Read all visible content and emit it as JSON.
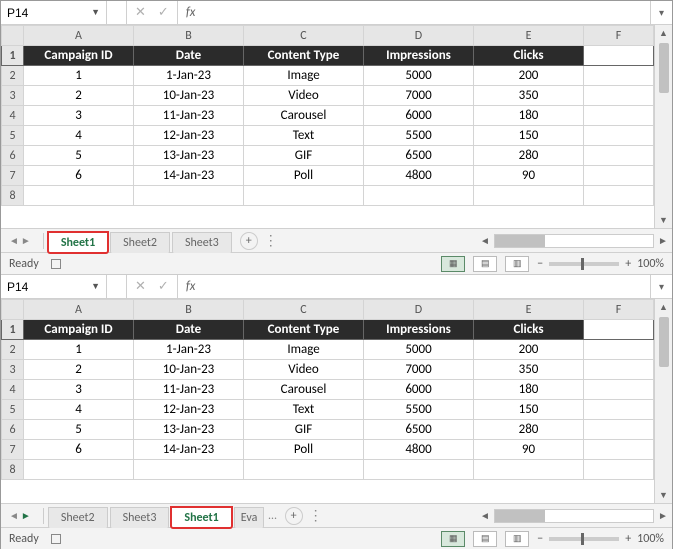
{
  "panes": [
    {
      "namebox": "P14",
      "fx": "fx",
      "cols": [
        "A",
        "B",
        "C",
        "D",
        "E",
        "F"
      ],
      "headers": [
        "Campaign ID",
        "Date",
        "Content Type",
        "Impressions",
        "Clicks"
      ],
      "rows": [
        {
          "n": "2",
          "c": [
            "1",
            "1-Jan-23",
            "Image",
            "5000",
            "200"
          ]
        },
        {
          "n": "3",
          "c": [
            "2",
            "10-Jan-23",
            "Video",
            "7000",
            "350"
          ]
        },
        {
          "n": "4",
          "c": [
            "3",
            "11-Jan-23",
            "Carousel",
            "6000",
            "180"
          ]
        },
        {
          "n": "5",
          "c": [
            "4",
            "12-Jan-23",
            "Text",
            "5500",
            "150"
          ]
        },
        {
          "n": "6",
          "c": [
            "5",
            "13-Jan-23",
            "GIF",
            "6500",
            "280"
          ]
        },
        {
          "n": "7",
          "c": [
            "6",
            "14-Jan-23",
            "Poll",
            "4800",
            "90"
          ]
        },
        {
          "n": "8",
          "c": [
            "",
            "",
            "",
            "",
            ""
          ]
        }
      ],
      "tabs": [
        {
          "label": "Sheet1",
          "active": true,
          "highlight": true
        },
        {
          "label": "Sheet2",
          "active": false,
          "highlight": false
        },
        {
          "label": "Sheet3",
          "active": false,
          "highlight": false
        }
      ],
      "status": "Ready",
      "zoom": "100%"
    },
    {
      "namebox": "P14",
      "fx": "fx",
      "cols": [
        "A",
        "B",
        "C",
        "D",
        "E",
        "F"
      ],
      "headers": [
        "Campaign ID",
        "Date",
        "Content Type",
        "Impressions",
        "Clicks"
      ],
      "rows": [
        {
          "n": "2",
          "c": [
            "1",
            "1-Jan-23",
            "Image",
            "5000",
            "200"
          ]
        },
        {
          "n": "3",
          "c": [
            "2",
            "10-Jan-23",
            "Video",
            "7000",
            "350"
          ]
        },
        {
          "n": "4",
          "c": [
            "3",
            "11-Jan-23",
            "Carousel",
            "6000",
            "180"
          ]
        },
        {
          "n": "5",
          "c": [
            "4",
            "12-Jan-23",
            "Text",
            "5500",
            "150"
          ]
        },
        {
          "n": "6",
          "c": [
            "5",
            "13-Jan-23",
            "GIF",
            "6500",
            "280"
          ]
        },
        {
          "n": "7",
          "c": [
            "6",
            "14-Jan-23",
            "Poll",
            "4800",
            "90"
          ]
        },
        {
          "n": "8",
          "c": [
            "",
            "",
            "",
            "",
            ""
          ]
        }
      ],
      "tabs": [
        {
          "label": "Sheet2",
          "active": false,
          "highlight": false
        },
        {
          "label": "Sheet3",
          "active": false,
          "highlight": false
        },
        {
          "label": "Sheet1",
          "active": true,
          "highlight": true
        },
        {
          "label": "Eva",
          "active": false,
          "highlight": false,
          "ellip": true
        }
      ],
      "status": "Ready",
      "zoom": "100%"
    }
  ]
}
